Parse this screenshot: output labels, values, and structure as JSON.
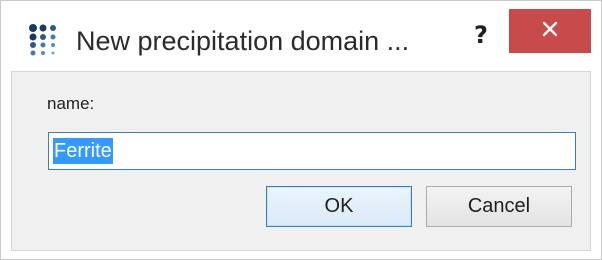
{
  "window": {
    "title": "New precipitation domain ...",
    "icon": "app-dots-icon",
    "help_label": "?",
    "close_icon": "close-icon",
    "close_color": "#c94a4a"
  },
  "form": {
    "name_label": "name:",
    "name_value": "Ferrite",
    "selection_color": "#3399ff"
  },
  "buttons": {
    "ok_label": "OK",
    "cancel_label": "Cancel"
  }
}
